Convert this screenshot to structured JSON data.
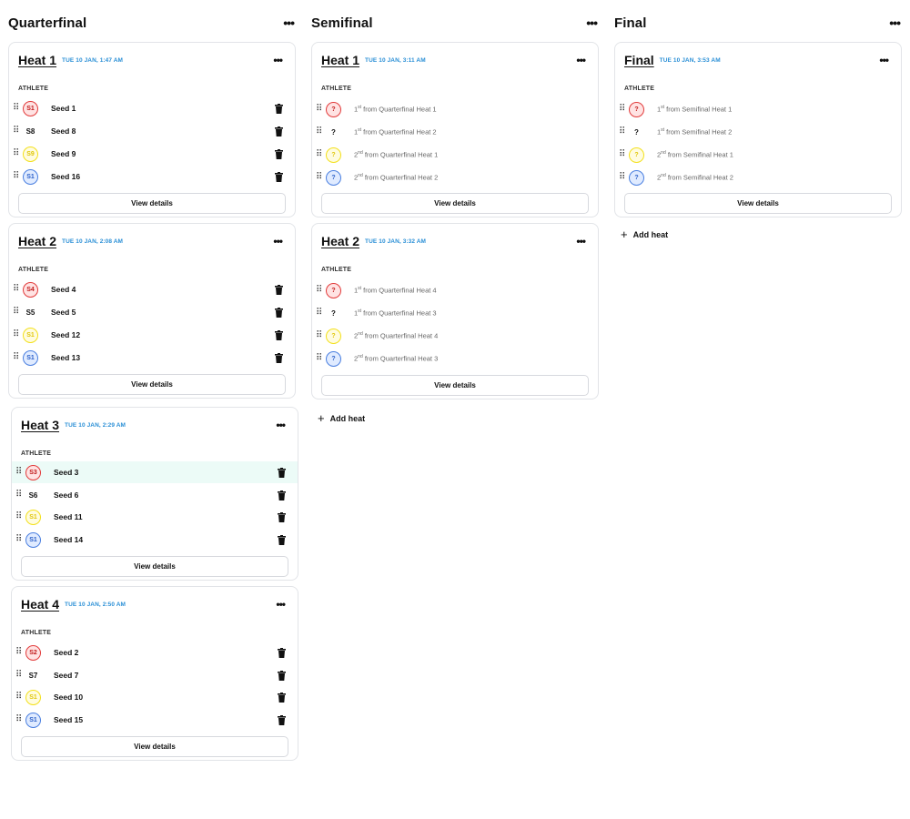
{
  "columns": [
    {
      "title": "Quarterfinal",
      "heats": [
        {
          "title": "Heat 1",
          "time": "TUE 10 JAN, 1:47 AM",
          "athlete_label": "ATHLETE",
          "view_label": "View details",
          "rows": [
            {
              "badge": "S1",
              "badge_color": "red",
              "label": "Seed 1"
            },
            {
              "badge": "S8",
              "badge_color": "plain",
              "label": "Seed 8"
            },
            {
              "badge": "S9",
              "badge_color": "yellow",
              "label": "Seed 9"
            },
            {
              "badge": "S1",
              "badge_color": "blue",
              "label": "Seed 16"
            }
          ]
        },
        {
          "title": "Heat 2",
          "time": "TUE 10 JAN, 2:08 AM",
          "athlete_label": "ATHLETE",
          "view_label": "View details",
          "rows": [
            {
              "badge": "S4",
              "badge_color": "red",
              "label": "Seed 4"
            },
            {
              "badge": "S5",
              "badge_color": "plain",
              "label": "Seed 5"
            },
            {
              "badge": "S1",
              "badge_color": "yellow",
              "label": "Seed 12"
            },
            {
              "badge": "S1",
              "badge_color": "blue",
              "label": "Seed 13"
            }
          ]
        },
        {
          "title": "Heat 3",
          "time": "TUE 10 JAN, 2:29 AM",
          "athlete_label": "ATHLETE",
          "view_label": "View details",
          "rows": [
            {
              "badge": "S3",
              "badge_color": "red",
              "label": "Seed 3"
            },
            {
              "badge": "S6",
              "badge_color": "plain",
              "label": "Seed 6"
            },
            {
              "badge": "S1",
              "badge_color": "yellow",
              "label": "Seed 11"
            },
            {
              "badge": "S1",
              "badge_color": "blue",
              "label": "Seed 14"
            }
          ]
        },
        {
          "title": "Heat 4",
          "time": "TUE 10 JAN, 2:50 AM",
          "athlete_label": "ATHLETE",
          "view_label": "View details",
          "rows": [
            {
              "badge": "S2",
              "badge_color": "red",
              "label": "Seed 2"
            },
            {
              "badge": "S7",
              "badge_color": "plain",
              "label": "Seed 7"
            },
            {
              "badge": "S1",
              "badge_color": "yellow",
              "label": "Seed 10"
            },
            {
              "badge": "S1",
              "badge_color": "blue",
              "label": "Seed 15"
            }
          ]
        }
      ]
    },
    {
      "title": "Semifinal",
      "add_heat_label": "Add heat",
      "heats": [
        {
          "title": "Heat 1",
          "time": "TUE 10 JAN, 3:11 AM",
          "athlete_label": "ATHLETE",
          "view_label": "View details",
          "rows": [
            {
              "badge": "?",
              "badge_color": "red",
              "rank": "1",
              "suffix": "st",
              "label": " from Quarterfinal Heat 1"
            },
            {
              "badge": "?",
              "badge_color": "plain",
              "rank": "1",
              "suffix": "st",
              "label": " from Quarterfinal Heat 2"
            },
            {
              "badge": "?",
              "badge_color": "yellow",
              "rank": "2",
              "suffix": "nd",
              "label": " from Quarterfinal Heat 1"
            },
            {
              "badge": "?",
              "badge_color": "blue",
              "rank": "2",
              "suffix": "nd",
              "label": " from Quarterfinal Heat 2"
            }
          ]
        },
        {
          "title": "Heat 2",
          "time": "TUE 10 JAN, 3:32 AM",
          "athlete_label": "ATHLETE",
          "view_label": "View details",
          "rows": [
            {
              "badge": "?",
              "badge_color": "red",
              "rank": "1",
              "suffix": "st",
              "label": " from Quarterfinal Heat 4"
            },
            {
              "badge": "?",
              "badge_color": "plain",
              "rank": "1",
              "suffix": "st",
              "label": " from Quarterfinal Heat 3"
            },
            {
              "badge": "?",
              "badge_color": "yellow",
              "rank": "2",
              "suffix": "nd",
              "label": " from Quarterfinal Heat 4"
            },
            {
              "badge": "?",
              "badge_color": "blue",
              "rank": "2",
              "suffix": "nd",
              "label": " from Quarterfinal Heat 3"
            }
          ]
        }
      ]
    },
    {
      "title": "Final",
      "add_heat_label": "Add heat",
      "heats": [
        {
          "title": "Final",
          "time": "TUE 10 JAN, 3:53 AM",
          "athlete_label": "ATHLETE",
          "view_label": "View details",
          "rows": [
            {
              "badge": "?",
              "badge_color": "red",
              "rank": "1",
              "suffix": "st",
              "label": " from Semifinal Heat 1"
            },
            {
              "badge": "?",
              "badge_color": "plain",
              "rank": "1",
              "suffix": "st",
              "label": " from Semifinal Heat 2"
            },
            {
              "badge": "?",
              "badge_color": "yellow",
              "rank": "2",
              "suffix": "nd",
              "label": " from Semifinal Heat 1"
            },
            {
              "badge": "?",
              "badge_color": "blue",
              "rank": "2",
              "suffix": "nd",
              "label": " from Semifinal Heat 2"
            }
          ]
        }
      ]
    }
  ],
  "icons": {
    "more": "more-horizontal-icon",
    "drag": "drag-handle-icon",
    "trash": "trash-icon",
    "add": "plus-icon"
  },
  "colors": {
    "accent_time": "#2a8fd6",
    "row_highlight": "#ecfbf7",
    "badge_red": "#e23b3b",
    "badge_yellow": "#f3e01b",
    "badge_blue": "#4a7fe0"
  }
}
